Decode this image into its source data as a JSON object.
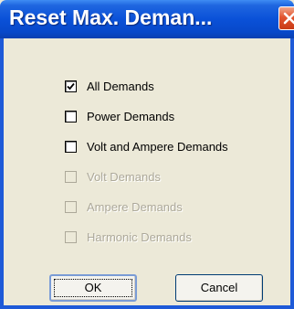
{
  "window": {
    "title": "Reset Max. Deman..."
  },
  "options": [
    {
      "label": "All Demands",
      "checked": true,
      "enabled": true
    },
    {
      "label": "Power Demands",
      "checked": false,
      "enabled": true
    },
    {
      "label": "Volt and Ampere Demands",
      "checked": false,
      "enabled": true
    },
    {
      "label": "Volt Demands",
      "checked": false,
      "enabled": false
    },
    {
      "label": "Ampere Demands",
      "checked": false,
      "enabled": false
    },
    {
      "label": "Harmonic Demands",
      "checked": false,
      "enabled": false
    }
  ],
  "buttons": {
    "ok_label": "OK",
    "cancel_label": "Cancel"
  },
  "colors": {
    "titlebar": "#0a51d8",
    "window_bg": "#ece9d8",
    "disabled_text": "#aca899",
    "close_button": "#e2542f"
  },
  "icons": {
    "close": "close-icon",
    "check": "checkmark-icon"
  }
}
